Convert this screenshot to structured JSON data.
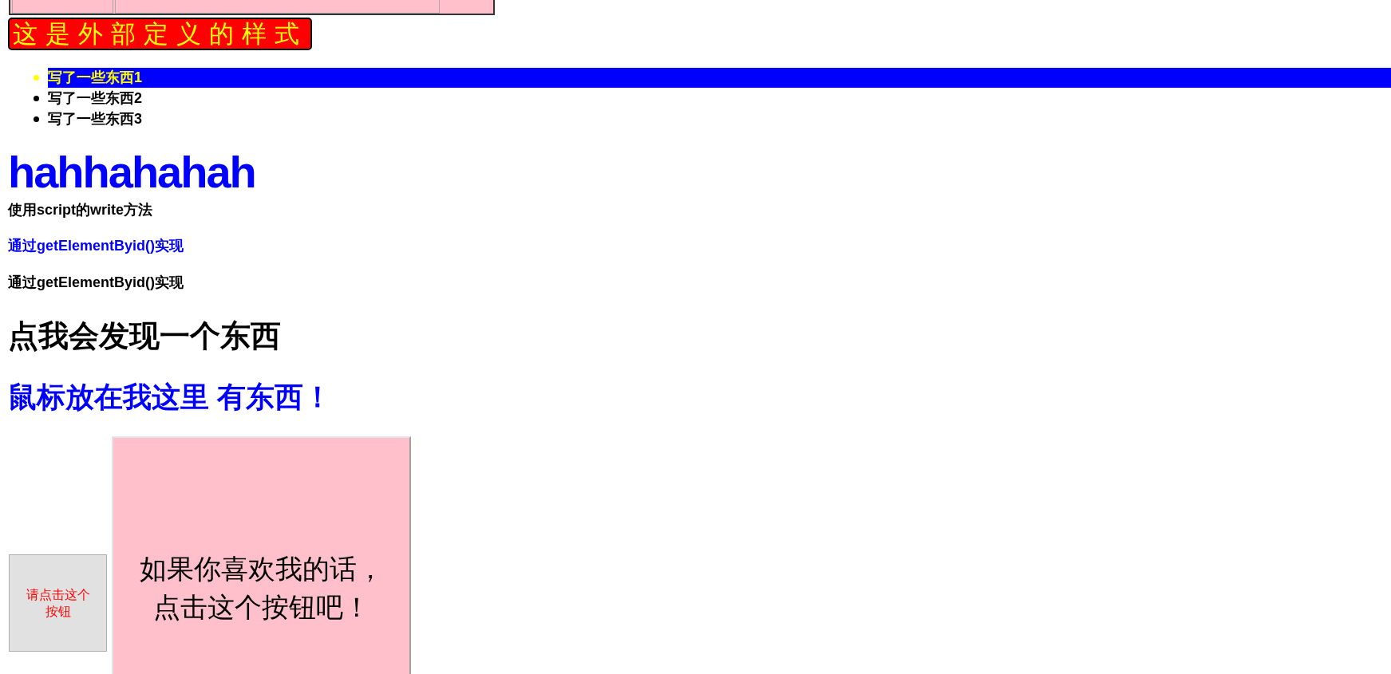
{
  "banner": {
    "text": "这是外部定义的样式"
  },
  "list": [
    {
      "text": "写了一些东西1",
      "highlighted": true
    },
    {
      "text": "写了一些东西2",
      "highlighted": false
    },
    {
      "text": "写了一些东西3",
      "highlighted": false
    }
  ],
  "heading": "hahhahahah",
  "paragraphs": [
    {
      "text": "使用script的write方法",
      "color": "#000000"
    },
    {
      "text": "通过getElementByid()实现",
      "color": "#0000ff"
    },
    {
      "text": "通过getElementByid()实现",
      "color": "#000000"
    }
  ],
  "click_heading": "点我会发现一个东西",
  "hover_heading": "鼠标放在我这里 有东西！",
  "buttons": [
    {
      "label": "请点击这个按钮",
      "kind": "small"
    },
    {
      "label": "如果你喜欢我的话，点击这个按钮吧！",
      "kind": "large"
    }
  ]
}
